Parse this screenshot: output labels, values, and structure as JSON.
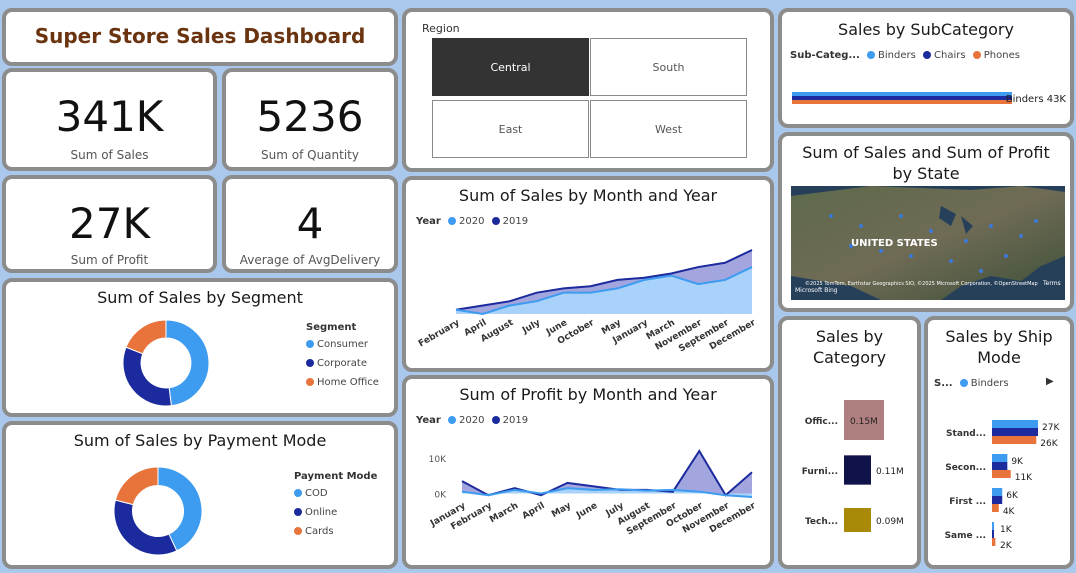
{
  "title": "Super Store Sales Dashboard",
  "kpis": [
    {
      "value": "341K",
      "label": "Sum of Sales"
    },
    {
      "value": "5236",
      "label": "Sum of Quantity"
    },
    {
      "value": "27K",
      "label": "Sum of Profit"
    },
    {
      "value": "4",
      "label": "Average of AvgDelivery"
    }
  ],
  "region_slicer": {
    "label": "Region",
    "options": [
      "Central",
      "South",
      "East",
      "West"
    ],
    "selected": "Central"
  },
  "colors": {
    "accent_light": "#3d9bf0",
    "accent_dark": "#1b2a9c",
    "orange": "#e8743b",
    "tile_border": "#8c8c8c",
    "title_brown": "#6b3410"
  },
  "segment_chart": {
    "title": "Sum of Sales by Segment",
    "legend_title": "Segment",
    "chart_data": {
      "type": "pie",
      "labels": [
        "Consumer",
        "Corporate",
        "Home Office"
      ],
      "values": [
        48,
        33,
        19
      ],
      "colors": [
        "#3d9bf0",
        "#1b2a9c",
        "#e8743b"
      ]
    }
  },
  "payment_chart": {
    "title": "Sum of Sales by Payment Mode",
    "legend_title": "Payment Mode",
    "chart_data": {
      "type": "pie",
      "labels": [
        "COD",
        "Online",
        "Cards"
      ],
      "values": [
        43,
        36,
        21
      ],
      "colors": [
        "#3d9bf0",
        "#1b2a9c",
        "#e8743b"
      ]
    }
  },
  "sales_month_chart": {
    "title": "Sum of Sales by Month and Year",
    "legend_title": "Year",
    "chart_data": {
      "type": "area",
      "categories": [
        "February",
        "April",
        "August",
        "July",
        "June",
        "October",
        "May",
        "January",
        "March",
        "November",
        "September",
        "December"
      ],
      "series": [
        {
          "name": "2020",
          "values": [
            1,
            0,
            2,
            3,
            5,
            5,
            6,
            8,
            9,
            7,
            8,
            11
          ]
        },
        {
          "name": "2019",
          "values": [
            1,
            2,
            3,
            5,
            6,
            6.5,
            8,
            8.5,
            9.5,
            11,
            12,
            15
          ]
        }
      ]
    }
  },
  "profit_month_chart": {
    "title": "Sum of Profit by Month and Year",
    "legend_title": "Year",
    "chart_data": {
      "type": "area",
      "categories": [
        "January",
        "February",
        "March",
        "April",
        "May",
        "June",
        "July",
        "August",
        "September",
        "October",
        "November",
        "December"
      ],
      "y_ticks": [
        "10K",
        "0K"
      ],
      "series": [
        {
          "name": "2020",
          "values": [
            0.5,
            -0.5,
            1,
            0,
            1.5,
            1,
            1.2,
            0.8,
            1,
            0.5,
            -0.5,
            -1
          ]
        },
        {
          "name": "2019",
          "values": [
            3.5,
            -0.5,
            1.5,
            -0.5,
            3,
            2,
            1,
            1,
            0.5,
            12,
            -0.5,
            6
          ]
        }
      ]
    }
  },
  "subcategory_chart": {
    "title": "Sales by SubCategory",
    "legend_title": "Sub-Categ...",
    "chart_data": {
      "type": "bar",
      "legend": [
        "Binders",
        "Chairs",
        "Phones"
      ],
      "categories": [
        "Binders"
      ],
      "series": [
        {
          "name": "Binders",
          "values": [
            43
          ]
        },
        {
          "name": "Chairs",
          "values": [
            43
          ]
        },
        {
          "name": "Phones",
          "values": [
            43
          ]
        }
      ],
      "data_labels": [
        "Binders 43K"
      ]
    }
  },
  "map": {
    "title": "Sum of Sales and Sum of Profit by State",
    "country_label": "UNITED STATES",
    "attribution": "©2025 TomTom, Earthstar Geographics SIO, ©2025 Microsoft Corporation, ©OpenStreetMap",
    "terms": "Terms",
    "brand": "Microsoft Bing"
  },
  "category_chart": {
    "title": "Sales by Category",
    "chart_data": {
      "type": "bar",
      "categories": [
        "Offic...",
        "Furni...",
        "Tech..."
      ],
      "values": [
        0.15,
        0.11,
        0.09
      ],
      "labels": [
        "0.15M",
        "0.11M",
        "0.09M"
      ],
      "colors": [
        "#b08080",
        "#10134a",
        "#a88a08"
      ]
    }
  },
  "ship_chart": {
    "title": "Sales by Ship Mode",
    "legend_title": "S...",
    "legend": [
      "Binders"
    ],
    "chart_data": {
      "type": "bar",
      "categories": [
        "Stand...",
        "Secon...",
        "First ...",
        "Same ..."
      ],
      "series": [
        {
          "name": "Binders",
          "values": [
            27,
            9,
            6,
            1
          ]
        },
        {
          "name": "Chairs",
          "values": [
            27,
            9,
            6,
            1
          ]
        },
        {
          "name": "Phones",
          "values": [
            26,
            11,
            4,
            2
          ]
        }
      ],
      "labels_top": [
        "27K",
        "9K",
        "6K",
        "1K"
      ],
      "labels_bottom": [
        "26K",
        "11K",
        "4K",
        "2K"
      ]
    }
  }
}
